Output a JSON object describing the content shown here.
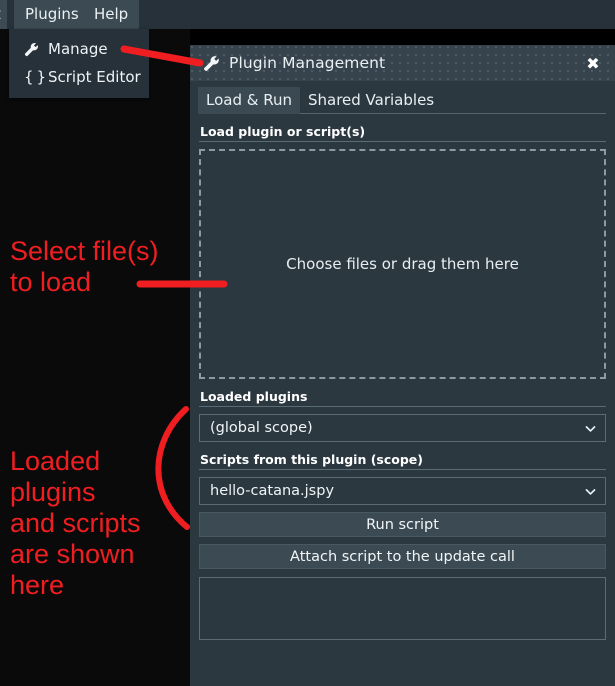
{
  "menubar": {
    "partial_item": "t",
    "items": [
      {
        "label": "Plugins",
        "name": "menu-plugins"
      },
      {
        "label": "Help",
        "name": "menu-help"
      }
    ]
  },
  "plugins_menu": {
    "items": [
      {
        "label": "Manage",
        "icon": "wrench-icon"
      },
      {
        "label": "Script Editor",
        "icon": "braces-icon"
      }
    ]
  },
  "dialog": {
    "title": "Plugin Management",
    "title_icon": "wrench-icon",
    "close_label": "✖",
    "tabs": [
      {
        "label": "Load & Run",
        "active": true
      },
      {
        "label": "Shared Variables",
        "active": false
      }
    ],
    "sections": {
      "load_label": "Load plugin or script(s)",
      "dropzone_text": "Choose files or drag them here",
      "loaded_plugins_label": "Loaded plugins",
      "loaded_plugins_value": "(global scope)",
      "scripts_label": "Scripts from this plugin (scope)",
      "scripts_value": "hello-catana.jspy"
    },
    "buttons": {
      "run_script": "Run script",
      "attach_script": "Attach script to the update call"
    },
    "output_pane_text": ""
  },
  "annotations": {
    "select_file": "Select file(s)\nto load",
    "loaded_plugins": "Loaded\nplugins\nand scripts\nare shown\nhere",
    "color": "#f01e20"
  },
  "colors": {
    "app_background": "#000000",
    "menubar": "#26313a",
    "menu_highlight": "#3c4a53",
    "dialog_background": "#2c3840",
    "titlebar": "#36434c",
    "tab_active": "#3b4952",
    "button": "#3c4a53",
    "border": "#5c6c75",
    "dashed_border": "#8d9aa2",
    "text": "#eef4f7",
    "annotation_red": "#f01e20"
  }
}
